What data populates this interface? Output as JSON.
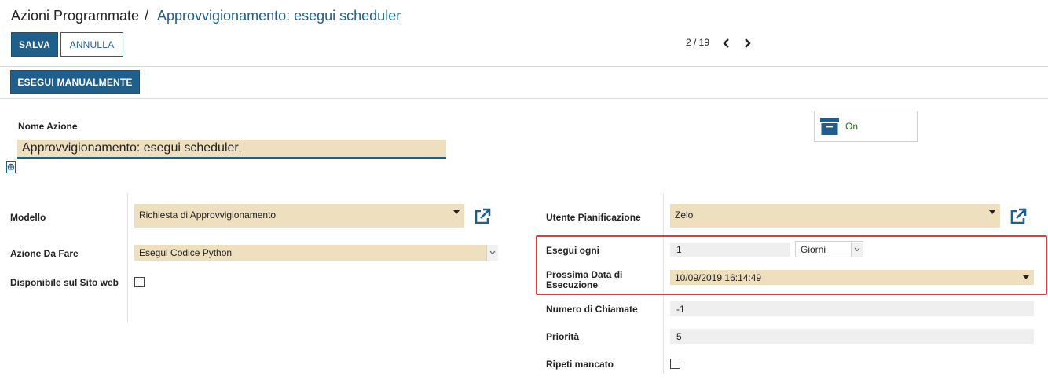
{
  "header": {
    "breadcrumb_root": "Azioni Programmate",
    "breadcrumb_separator": "/",
    "breadcrumb_current": "Approvvigionamento: esegui scheduler"
  },
  "toolbar": {
    "save_label": "SALVA",
    "cancel_label": "ANNULLA",
    "pager": "2 / 19",
    "prev_icon": "chevron-left-icon",
    "next_icon": "chevron-right-icon"
  },
  "actions": {
    "run_manually_label": "ESEGUI MANUALMENTE"
  },
  "form": {
    "name_label": "Nome Azione",
    "name_value": "Approvvigionamento: esegui scheduler",
    "active_toggle": {
      "label": "On",
      "icon": "archive-icon"
    },
    "left": {
      "model": {
        "label": "Modello",
        "value": "Richiesta di Approvvigionamento"
      },
      "action": {
        "label": "Azione Da Fare",
        "value": "Esegui Codice Python"
      },
      "website": {
        "label": "Disponibile sul Sito web",
        "checked": false
      }
    },
    "right": {
      "user": {
        "label": "Utente Pianificazione",
        "value": "Zelo"
      },
      "interval": {
        "label": "Esegui ogni",
        "number": "1",
        "unit": "Giorni"
      },
      "next_run": {
        "label": "Prossima Data di Esecuzione",
        "value": "10/09/2019 16:14:49"
      },
      "calls": {
        "label": "Numero di Chiamate",
        "value": "-1"
      },
      "priority": {
        "label": "Priorità",
        "value": "5"
      },
      "retry": {
        "label": "Ripeti mancato",
        "checked": false
      }
    }
  },
  "colors": {
    "primary": "#1f5f8b",
    "field_bg": "#eedfbf",
    "readonly_bg": "#efefef",
    "highlight": "#e0393e",
    "toggle_on": "#2a6b1f"
  }
}
